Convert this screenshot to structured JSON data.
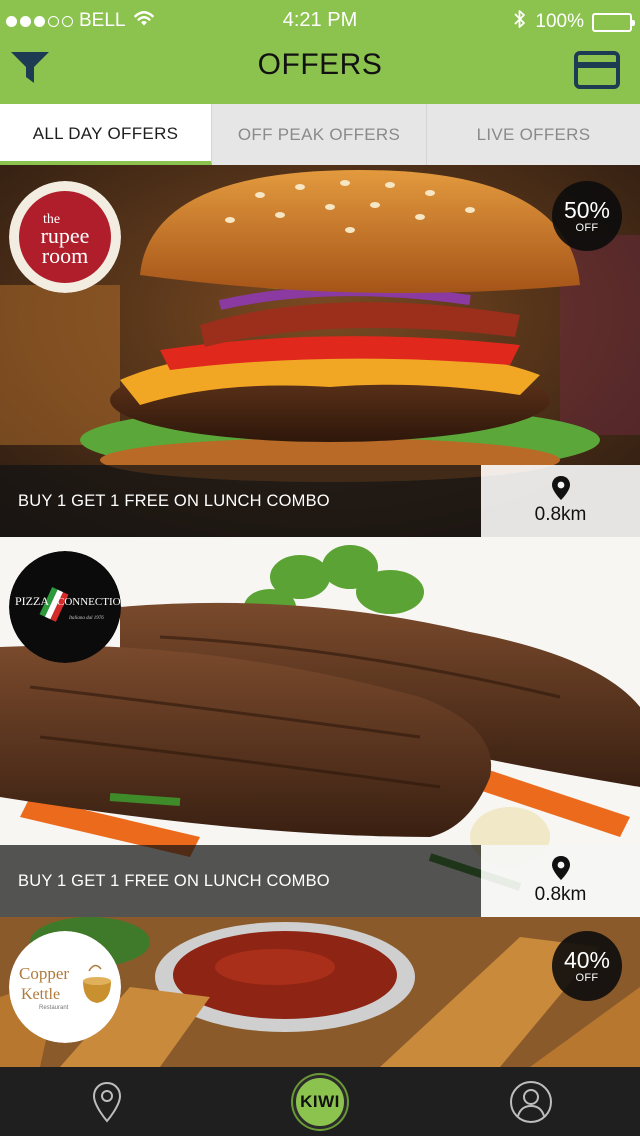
{
  "status_bar": {
    "signal_dots": 5,
    "signal_filled": 3,
    "carrier": "BELL",
    "time": "4:21 PM",
    "battery_text": "100%",
    "battery_level": 1.0,
    "icons": [
      "wifi-icon",
      "bluetooth-icon",
      "battery-icon"
    ]
  },
  "header": {
    "title": "OFFERS",
    "left_icon": "filter-icon",
    "right_icon": "card-icon",
    "background": "#8cc34e"
  },
  "tabs": [
    {
      "label": "ALL DAY OFFERS",
      "active": true
    },
    {
      "label": "OFF PEAK OFFERS",
      "active": false
    },
    {
      "label": "LIVE OFFERS",
      "active": false
    }
  ],
  "offers": [
    {
      "restaurant_logo_text": [
        "the",
        "rupee",
        "room"
      ],
      "image": "burger",
      "discount": "50%",
      "discount_label": "OFF",
      "title": "BUY 1 GET 1 FREE ON LUNCH COMBO",
      "distance": "0.8km"
    },
    {
      "restaurant_logo_text": [
        "PIZZA",
        "CONNECTION",
        "Italiana dal 1976"
      ],
      "image": "steak",
      "discount": "",
      "discount_label": "",
      "title": "BUY 1 GET 1 FREE ON LUNCH COMBO",
      "distance": "0.8km"
    },
    {
      "restaurant_logo_text": [
        "Copper",
        "Kettle",
        "Restaurant"
      ],
      "image": "fried-sticks",
      "discount": "40%",
      "discount_label": "OFF",
      "title": "",
      "distance": ""
    }
  ],
  "bottom_bar": {
    "items": [
      "location-icon",
      "kiwi-home",
      "profile-icon"
    ],
    "kiwi_label": "KIWI"
  },
  "colors": {
    "accent": "#8cc34e",
    "tab_inactive_bg": "#e6e6e6",
    "tabbar_bg": "#1f1f1f"
  }
}
